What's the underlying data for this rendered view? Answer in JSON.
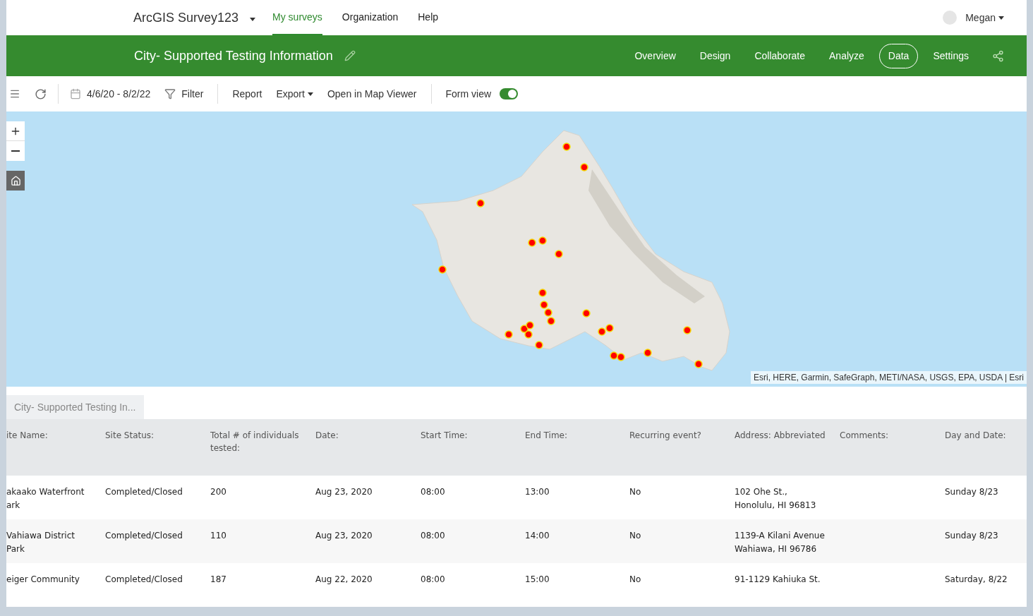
{
  "header": {
    "app_title": "ArcGIS Survey123",
    "nav": [
      {
        "label": "My surveys",
        "selected": true
      },
      {
        "label": "Organization",
        "selected": false
      },
      {
        "label": "Help",
        "selected": false
      }
    ],
    "user": "Megan"
  },
  "survey_bar": {
    "title": "City- Supported Testing Information",
    "tabs": [
      {
        "label": "Overview",
        "selected": false
      },
      {
        "label": "Design",
        "selected": false
      },
      {
        "label": "Collaborate",
        "selected": false
      },
      {
        "label": "Analyze",
        "selected": false
      },
      {
        "label": "Data",
        "selected": true
      },
      {
        "label": "Settings",
        "selected": false
      }
    ]
  },
  "toolbar": {
    "date_range": "4/6/20 - 8/2/22",
    "filter": "Filter",
    "actions": [
      {
        "label": "Report",
        "dropdown": false
      },
      {
        "label": "Export",
        "dropdown": true
      },
      {
        "label": "Open in Map Viewer",
        "dropdown": false
      }
    ],
    "form_view": {
      "label": "Form view",
      "on": true
    }
  },
  "map": {
    "attribution": "Esri, HERE, Garmin, SafeGraph, METI/NASA, USGS, EPA, USDA | Esri"
  },
  "table": {
    "tab": "City- Supported Testing In...",
    "columns": [
      "ite Name:",
      "Site Status:",
      "Total # of individuals tested:",
      "Date:",
      "Start Time:",
      "End Time:",
      "Recurring event?",
      "Address: Abbreviated",
      "Comments:",
      "Day and Date:"
    ],
    "rows": [
      [
        "akaako Waterfront ark",
        "Completed/Closed",
        "200",
        "Aug 23, 2020",
        "08:00",
        "13:00",
        "No",
        "102 Ohe St., Honolulu, HI 96813",
        "",
        "Sunday 8/23"
      ],
      [
        "Vahiawa District Park",
        "Completed/Closed",
        "110",
        "Aug 23, 2020",
        "08:00",
        "14:00",
        "No",
        "1139-A Kilani Avenue Wahiawa, HI 96786",
        "",
        "Sunday 8/23"
      ],
      [
        "eiger Community",
        "Completed/Closed",
        "187",
        "Aug 22, 2020",
        "08:00",
        "15:00",
        "No",
        "91-1129 Kahiuka St.",
        "",
        "Saturday, 8/22"
      ]
    ]
  }
}
